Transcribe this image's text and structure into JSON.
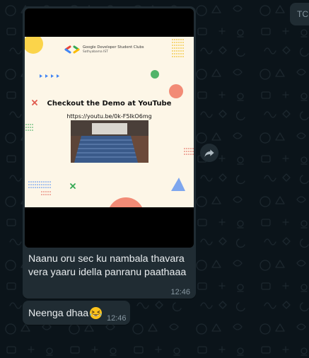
{
  "colors": {
    "background": "#0b141a",
    "bubble": "#202c33",
    "text": "#e9edef",
    "meta": "#8696a0",
    "poster_bg": "#fdf6e7",
    "google_blue": "#4285f4",
    "google_red": "#ea4335",
    "google_green": "#34a853",
    "google_yellow": "#fbbc04"
  },
  "incoming_partial": {
    "label": "TC"
  },
  "message_image": {
    "caption_line1": "Naanu oru sec ku nambala thavara",
    "caption_line2": "vera yaaru idella panranu paathaaa",
    "time": "12:46",
    "poster": {
      "org_name": "Google Developer Student Clubs",
      "org_sub": "Sathyabama IST",
      "title": "Checkout the Demo at YouTube",
      "url": "https://youtu.be/0k-F5IkO6mg"
    }
  },
  "message_text": {
    "text": "Neenga dhaa",
    "emoji": "grinning-squinting-face-with-tears",
    "time": "12:46"
  },
  "forward_icon": "forward-arrow-icon"
}
